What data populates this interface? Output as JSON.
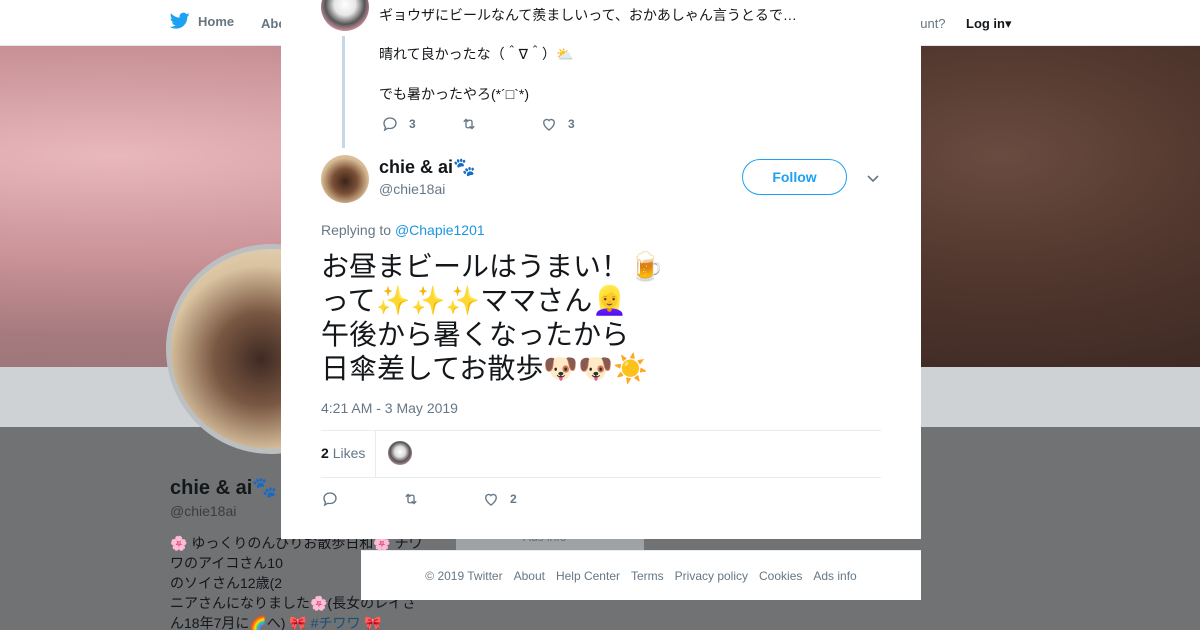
{
  "nav": {
    "home_label": "Home",
    "about_label": "Abo",
    "account_prompt": "ccount?",
    "login_label": "Log in"
  },
  "background_profile": {
    "name": "chie & ai",
    "handle": "@chie18ai",
    "bio_line1": "🌸 ゆっくりのんびりお散歩日和🌸 チワ",
    "bio_line2": "ワのアイコさん10",
    "bio_line3": "のソイさん12歳(2",
    "bio_line4": "ニアさんになりました🌸(長女のレイさ",
    "bio_line5_prefix": "ん18年7月に🌈へ) 🎀",
    "bio_hashtag": "#チワワ",
    "bio_line5_suffix": "🎀",
    "card_text": "Ads info"
  },
  "thread": {
    "previous_lines": [
      "ギョウザにビールなんて羨ましいって、おかあしゃん言うとるで…",
      "晴れて良かったな（＾∇＾）⛅",
      "でも暑かったやろ(*´□`*)"
    ],
    "previous_actions": {
      "replies": "3",
      "retweets": "",
      "likes": "3"
    }
  },
  "tweet": {
    "name": "chie & ai",
    "name_emoji": "🐾",
    "handle": "@chie18ai",
    "follow_label": "Follow",
    "replying_prefix": "Replying to",
    "replying_mention": "@Chapie1201",
    "text_lines": [
      "お昼まビールはうまい！🍺",
      "って✨✨✨ママさん👱‍♀️",
      "午後から暑くなったから",
      "日傘差してお散歩🐶🐶☀️"
    ],
    "timestamp": "4:21 AM - 3 May 2019",
    "likes_count": "2",
    "likes_label": "Likes",
    "actions": {
      "replies": "",
      "retweets": "",
      "likes": "2"
    }
  },
  "footer": {
    "links": [
      "© 2019 Twitter",
      "About",
      "Help Center",
      "Terms",
      "Privacy policy",
      "Cookies",
      "Ads info"
    ]
  },
  "colors": {
    "accent": "#1da1f2",
    "mention": "#1b95e0",
    "muted": "#657786",
    "text": "#14171a"
  }
}
